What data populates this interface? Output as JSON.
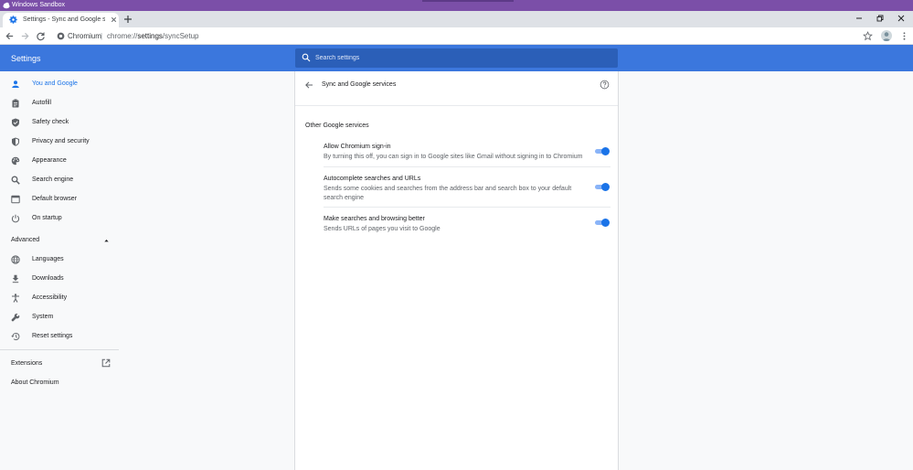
{
  "os": {
    "title": "Windows Sandbox"
  },
  "browser": {
    "tab_title": "Settings - Sync and Google services",
    "omnibox": {
      "site_name": "Chromium",
      "separator": "|",
      "url_prefix": "chrome://",
      "url_host": "settings",
      "url_path": "/syncSetup"
    }
  },
  "header": {
    "title": "Settings",
    "search_placeholder": "Search settings"
  },
  "sidebar": {
    "items": [
      {
        "label": "You and Google",
        "icon": "person-icon",
        "active": true
      },
      {
        "label": "Autofill",
        "icon": "clipboard-icon"
      },
      {
        "label": "Safety check",
        "icon": "shield-check-icon"
      },
      {
        "label": "Privacy and security",
        "icon": "shield-icon"
      },
      {
        "label": "Appearance",
        "icon": "palette-icon"
      },
      {
        "label": "Search engine",
        "icon": "search-icon"
      },
      {
        "label": "Default browser",
        "icon": "browser-icon"
      },
      {
        "label": "On startup",
        "icon": "power-icon"
      }
    ],
    "advanced": {
      "label": "Advanced",
      "expanded": true
    },
    "advanced_items": [
      {
        "label": "Languages",
        "icon": "globe-icon"
      },
      {
        "label": "Downloads",
        "icon": "download-icon"
      },
      {
        "label": "Accessibility",
        "icon": "accessibility-icon"
      },
      {
        "label": "System",
        "icon": "wrench-icon"
      },
      {
        "label": "Reset settings",
        "icon": "restore-icon"
      }
    ],
    "extensions_label": "Extensions",
    "about_label": "About Chromium"
  },
  "main": {
    "page_title": "Sync and Google services",
    "section_title": "Other Google services",
    "rows": [
      {
        "label": "Allow Chromium sign-in",
        "sublabel": "By turning this off, you can sign in to Google sites like Gmail without signing in to Chromium",
        "enabled": true
      },
      {
        "label": "Autocomplete searches and URLs",
        "sublabel": "Sends some cookies and searches from the address bar and search box to your default search engine",
        "enabled": true
      },
      {
        "label": "Make searches and browsing better",
        "sublabel": "Sends URLs of pages you visit to Google",
        "enabled": true
      }
    ]
  },
  "colors": {
    "header_blue": "#3b77dd",
    "accent": "#1a73e8",
    "os_bar": "#7b4fa8"
  }
}
